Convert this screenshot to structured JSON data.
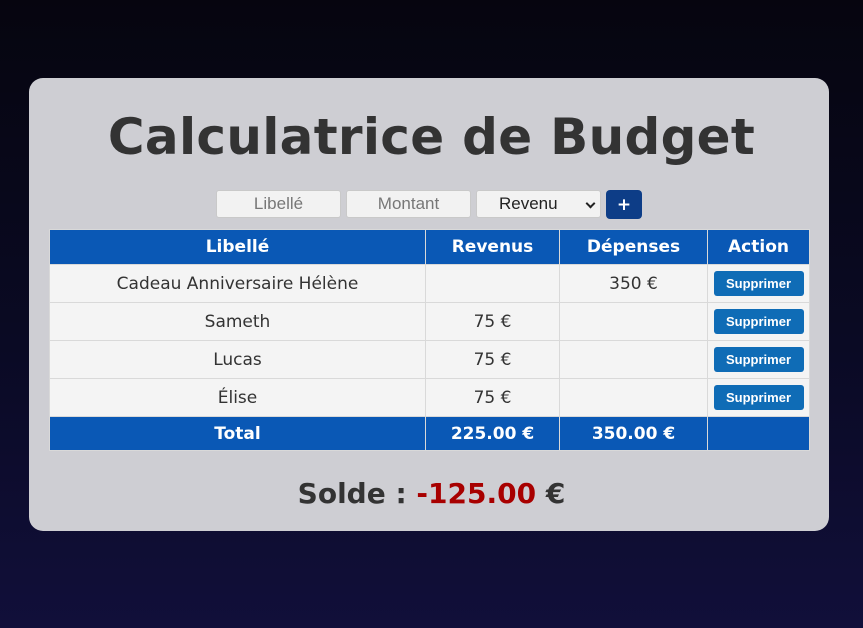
{
  "app": {
    "title": "Calculatrice de Budget"
  },
  "form": {
    "label_placeholder": "Libellé",
    "amount_placeholder": "Montant",
    "type_selected": "Revenu",
    "add_button": "+"
  },
  "table": {
    "headers": {
      "label": "Libellé",
      "income": "Revenus",
      "expense": "Dépenses",
      "action": "Action"
    },
    "rows": [
      {
        "label": "Cadeau Anniversaire Hélène",
        "income": "",
        "expense": "350 €",
        "action": "Supprimer"
      },
      {
        "label": "Sameth",
        "income": "75 €",
        "expense": "",
        "action": "Supprimer"
      },
      {
        "label": "Lucas",
        "income": "75 €",
        "expense": "",
        "action": "Supprimer"
      },
      {
        "label": "Élise",
        "income": "75 €",
        "expense": "",
        "action": "Supprimer"
      }
    ],
    "footer": {
      "label": "Total",
      "income_total": "225.00 €",
      "expense_total": "350.00 €"
    }
  },
  "balance": {
    "label": "Solde :",
    "value": "-125.00",
    "currency": "€"
  },
  "colors": {
    "header_blue": "#0a58b5",
    "button_blue": "#0f6cb6",
    "add_button": "#0d3d87",
    "negative": "#a80000",
    "card": "#ceced3"
  }
}
